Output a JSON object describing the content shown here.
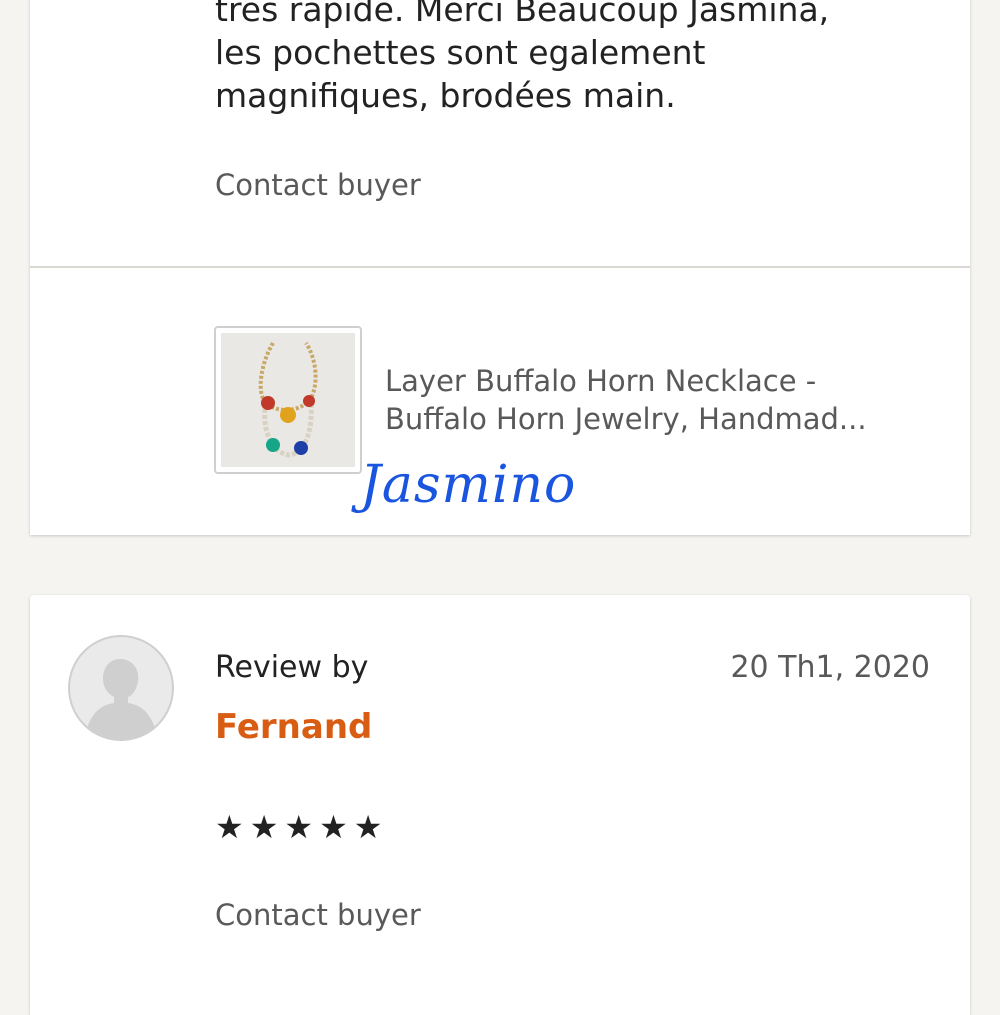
{
  "top_review": {
    "text_lines": [
      "tres rapide. Merci Beaucoup Jasmina,",
      "les pochettes sont egalement",
      "magnifiques, brodées main."
    ],
    "contact_label": "Contact buyer",
    "listing": {
      "title_lines": [
        "Layer Buffalo Horn Necklace -",
        "Buffalo Horn Jewelry, Handmad..."
      ]
    },
    "signature": "Jasmino"
  },
  "fernand_review": {
    "review_by_label": "Review by",
    "reviewer_name": "Fernand",
    "date": "20 Th1, 2020",
    "stars": "★★★★★",
    "contact_label": "Contact buyer"
  },
  "colors": {
    "accent": "#d95c13",
    "signature": "#1a55e0",
    "background": "#f5f4f1"
  },
  "icons": {
    "avatar": "person-silhouette-icon"
  }
}
